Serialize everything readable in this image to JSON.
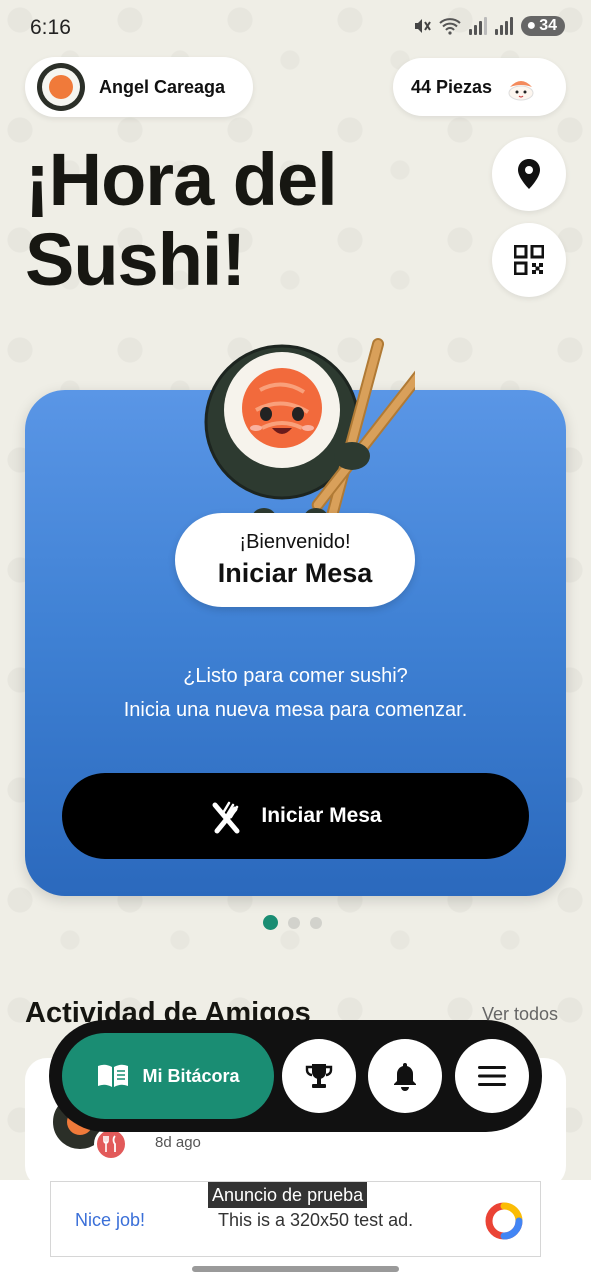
{
  "status_bar": {
    "time": "6:16",
    "battery": "34"
  },
  "header": {
    "user_name": "Angel Careaga",
    "pieces_label": "44 Piezas"
  },
  "title": {
    "line1": "¡Hora del",
    "line2": "Sushi!"
  },
  "card": {
    "welcome_small": "¡Bienvenido!",
    "welcome_big": "Iniciar Mesa",
    "text_line1": "¿Listo para comer sushi?",
    "text_line2": "Inicia una nueva mesa para comenzar.",
    "button_label": "Iniciar Mesa",
    "colors": {
      "top": "#5a96e6",
      "bottom": "#2b69bd"
    }
  },
  "carousel": {
    "pages": 3,
    "active": 0
  },
  "friends": {
    "section_title": "Actividad de Amigos",
    "see_all": "Ver todos",
    "items": [
      {
        "time": "8d ago"
      }
    ]
  },
  "nav": {
    "main_label": "Mi Bitácora",
    "accent": "#1a8d73",
    "icons": [
      "book-icon",
      "trophy-icon",
      "bell-icon",
      "menu-icon"
    ]
  },
  "ad": {
    "badge": "Anuncio de prueba",
    "nice": "Nice job!",
    "text": "This is a 320x50 test ad."
  }
}
